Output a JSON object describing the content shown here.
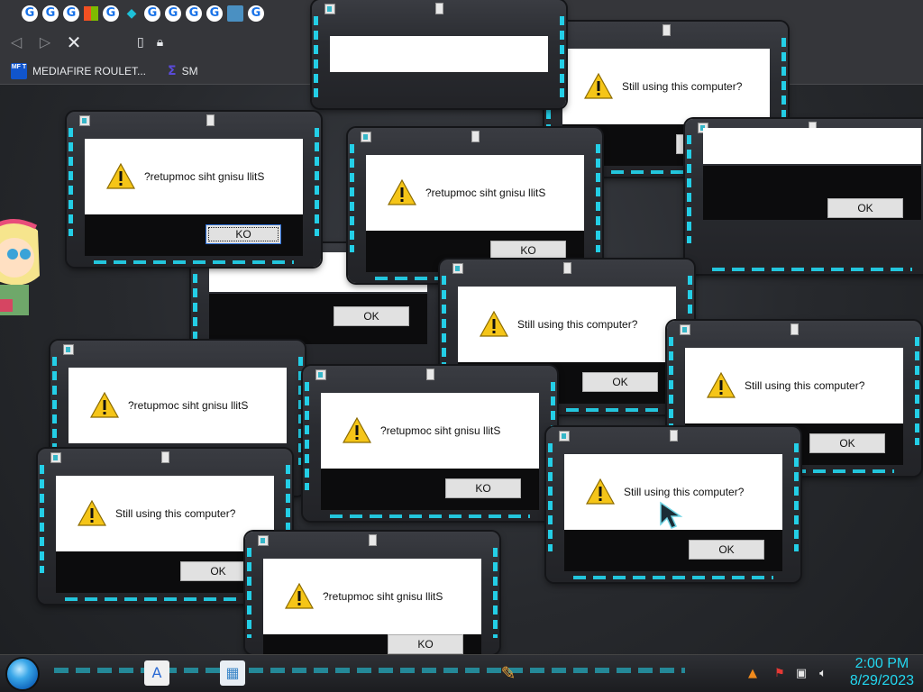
{
  "browser": {
    "tab_favicons": [
      "G",
      "G",
      "G",
      "win",
      "G",
      "diamond",
      "G",
      "G",
      "G",
      "G",
      "img",
      "G"
    ],
    "nav": {
      "back_icon": "back-arrow-icon",
      "forward_icon": "forward-arrow-icon",
      "stop_icon": "stop-x-icon"
    },
    "bookmarks": [
      {
        "icon_text": "MF T",
        "label": "MEDIAFIRE ROULET..."
      },
      {
        "icon_text": "Σ",
        "label": "SM"
      }
    ]
  },
  "dialogs": [
    {
      "message": "Still using this computer?",
      "button": "OK"
    },
    {
      "message": "Still using this computer?",
      "button": "OK"
    },
    {
      "message": "?retupmoc siht gnisu llitS",
      "button": "KO"
    },
    {
      "message": "?retupmoc siht gnisu llitS",
      "button": "KO"
    },
    {
      "message": "Still using this computer?",
      "button": "OK"
    },
    {
      "message": "Still using this computer?",
      "button": "OK"
    },
    {
      "message": "Still using this computer?",
      "button": "OK"
    },
    {
      "message": "?retupmoc siht gnisu llitS",
      "button": "KO"
    },
    {
      "message": "?retupmoc siht gnisu llitS",
      "button": "KO"
    },
    {
      "message": "Still using this computer?",
      "button": "OK"
    },
    {
      "message": "Still using this computer?",
      "button": "OK"
    },
    {
      "message": "?retupmoc siht gnisu llitS",
      "button": "KO"
    }
  ],
  "taskbar": {
    "time": "2:00 PM",
    "date": "8/29/2023"
  },
  "colors": {
    "accent": "#23d7f0",
    "dialog_body": "#ffffff",
    "dialog_footer": "#0c0c0d"
  }
}
